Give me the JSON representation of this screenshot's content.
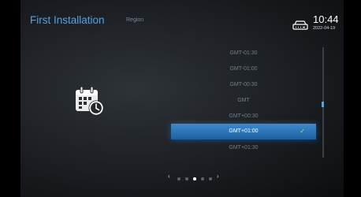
{
  "header": {
    "title": "First Installation",
    "subtitle": "Region",
    "time": "10:44",
    "date": "2022-04-19",
    "network_icon": "router-icon"
  },
  "page_icon": "calendar-clock-icon",
  "timezone_list": {
    "items": [
      {
        "label": "GMT-01:30",
        "selected": false
      },
      {
        "label": "GMT-01:00",
        "selected": false
      },
      {
        "label": "GMT-00:30",
        "selected": false
      },
      {
        "label": "GMT",
        "selected": false
      },
      {
        "label": "GMT+00:30",
        "selected": false
      },
      {
        "label": "GMT+01:00",
        "selected": true
      },
      {
        "label": "GMT+01:30",
        "selected": false
      }
    ],
    "check_mark": "✓"
  },
  "pager": {
    "left_arrow": "‹",
    "right_arrow": "›",
    "total_pages": 5,
    "current_page": 3
  },
  "colors": {
    "accent": "#4fa4e6",
    "selection": "#2a76bb",
    "check": "#c6d84a"
  }
}
